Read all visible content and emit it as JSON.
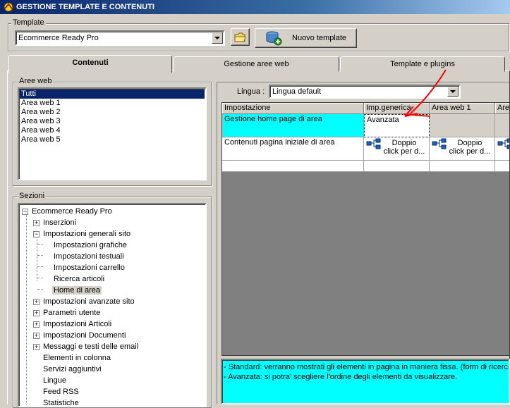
{
  "window": {
    "title": "GESTIONE TEMPLATE E CONTENUTI"
  },
  "template": {
    "group_label": "Template",
    "selected": "Ecommerce Ready Pro",
    "new_button_label": "Nuovo template"
  },
  "tabs": [
    {
      "label": "Contenuti",
      "active": true
    },
    {
      "label": "Gestione aree web",
      "active": false
    },
    {
      "label": "Template e plugins",
      "active": false
    }
  ],
  "aree_web": {
    "group_label": "Aree web",
    "items": [
      "Tutti",
      "Area web 1",
      "Area web 2",
      "Area web 3",
      "Area web 4",
      "Area web 5"
    ],
    "selected_index": 0
  },
  "sezioni": {
    "group_label": "Sezioni",
    "tree": [
      {
        "label": "Ecommerce Ready Pro",
        "level": 0,
        "expander": "minus"
      },
      {
        "label": "Inserzioni",
        "level": 1,
        "expander": "plus"
      },
      {
        "label": "Impostazioni generali sito",
        "level": 1,
        "expander": "minus"
      },
      {
        "label": "Impostazioni grafiche",
        "level": 2,
        "expander": "none"
      },
      {
        "label": "Impostazioni testuali",
        "level": 2,
        "expander": "none"
      },
      {
        "label": "Impostazioni carrello",
        "level": 2,
        "expander": "none"
      },
      {
        "label": "Ricerca articoli",
        "level": 2,
        "expander": "none"
      },
      {
        "label": "Home di area",
        "level": 2,
        "expander": "none",
        "selected": true
      },
      {
        "label": "Impostazioni avanzate sito",
        "level": 1,
        "expander": "plus"
      },
      {
        "label": "Parametri utente",
        "level": 1,
        "expander": "plus"
      },
      {
        "label": "Impostazioni Articoli",
        "level": 1,
        "expander": "plus"
      },
      {
        "label": "Impostazioni Documenti",
        "level": 1,
        "expander": "plus"
      },
      {
        "label": "Messaggi e testi delle email",
        "level": 1,
        "expander": "plus"
      },
      {
        "label": "Elementi in colonna",
        "level": 1,
        "expander": "none"
      },
      {
        "label": "Servizi aggiuntivi",
        "level": 1,
        "expander": "none"
      },
      {
        "label": "Lingue",
        "level": 1,
        "expander": "none"
      },
      {
        "label": "Feed RSS",
        "level": 1,
        "expander": "none"
      },
      {
        "label": "Statistiche",
        "level": 1,
        "expander": "none"
      }
    ]
  },
  "lingua": {
    "label": "Lingua :",
    "selected": "Lingua default"
  },
  "grid": {
    "columns": [
      "Impostazione",
      "Imp.generica",
      "Area web 1",
      "Area"
    ],
    "rows": [
      {
        "impostazione": "Gestione home page di area",
        "imp_generica": "Avanzata",
        "area_web_1": "",
        "area": ""
      },
      {
        "impostazione": "Contenuti pagina iniziale di area",
        "cell_text_line1": "Doppio",
        "cell_text_line2": "click per d..."
      }
    ]
  },
  "description": {
    "lines": [
      "- Standard: verranno mostrati gli elementi in pagina in maniera fissa. (form di ricerca,",
      "- Avanzata: si potra' scegliere l'ordine degli elementi da visualizzare."
    ]
  },
  "colors": {
    "highlight": "#00ffff",
    "selection": "#0a246a",
    "annotation_arrow": "#ff0000",
    "grid_empty_area": "#808080"
  }
}
